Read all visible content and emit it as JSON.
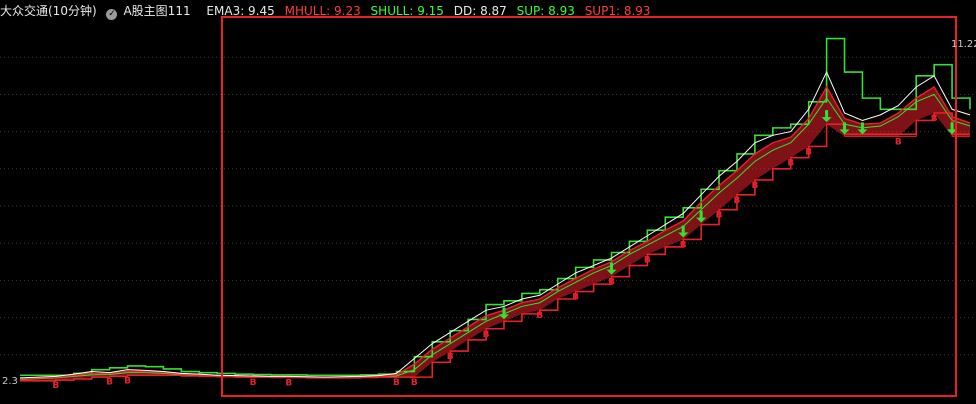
{
  "header": {
    "title": "大众交通(10分钟)",
    "indicator": "A股主图111",
    "ema3": "EMA3: 9.45",
    "mhull": "MHULL: 9.23",
    "shull": "SHULL: 9.15",
    "dd": "DD: 8.87",
    "sup": "SUP: 8.93",
    "sup1": "SUP1: 8.93"
  },
  "colors": {
    "background": "#000000",
    "price_line": "#ffffff",
    "red_band": "#e8202a",
    "green_band": "#35e035",
    "grid": "#3a3a3a",
    "frame": "#e8202a"
  },
  "chart_data": {
    "type": "line",
    "title": "大众交通(10分钟)",
    "xlabel": "",
    "ylabel": "",
    "ylim": [
      2.0,
      12.0
    ],
    "grid": true,
    "y_ticks_visible": [
      "2.3",
      "11.22"
    ],
    "legend": "top-left inline",
    "series": [
      {
        "name": "EMA3",
        "values": [
          2.38,
          2.4,
          2.42,
          2.48,
          2.55,
          2.52,
          2.6,
          2.58,
          2.55,
          2.5,
          2.48,
          2.45,
          2.44,
          2.43,
          2.42,
          2.42,
          2.41,
          2.4,
          2.41,
          2.42,
          2.44,
          2.5,
          2.9,
          3.3,
          3.6,
          3.9,
          4.2,
          4.3,
          4.5,
          4.6,
          4.9,
          5.2,
          5.4,
          5.6,
          5.9,
          6.2,
          6.5,
          6.8,
          7.3,
          7.8,
          8.2,
          8.7,
          8.9,
          9.0,
          9.6,
          10.6,
          9.5,
          9.3,
          9.45,
          9.7,
          10.2,
          10.5,
          9.6,
          9.45
        ]
      },
      {
        "name": "MHULL",
        "values": [
          2.36,
          2.38,
          2.4,
          2.45,
          2.5,
          2.5,
          2.56,
          2.55,
          2.53,
          2.49,
          2.46,
          2.44,
          2.43,
          2.42,
          2.41,
          2.41,
          2.4,
          2.4,
          2.4,
          2.41,
          2.42,
          2.46,
          2.75,
          3.15,
          3.45,
          3.75,
          4.05,
          4.2,
          4.4,
          4.5,
          4.8,
          5.05,
          5.3,
          5.5,
          5.8,
          6.05,
          6.35,
          6.6,
          7.1,
          7.55,
          7.95,
          8.4,
          8.7,
          8.85,
          9.35,
          10.2,
          9.35,
          9.2,
          9.23,
          9.5,
          9.9,
          10.2,
          9.4,
          9.23
        ]
      },
      {
        "name": "SHULL",
        "values": [
          2.34,
          2.36,
          2.38,
          2.42,
          2.46,
          2.47,
          2.52,
          2.52,
          2.5,
          2.47,
          2.45,
          2.43,
          2.42,
          2.41,
          2.4,
          2.4,
          2.39,
          2.39,
          2.39,
          2.4,
          2.41,
          2.43,
          2.6,
          3.0,
          3.3,
          3.6,
          3.9,
          4.1,
          4.3,
          4.4,
          4.7,
          4.95,
          5.2,
          5.4,
          5.7,
          5.95,
          6.2,
          6.45,
          6.9,
          7.35,
          7.75,
          8.2,
          8.5,
          8.7,
          9.2,
          9.9,
          9.2,
          9.1,
          9.15,
          9.4,
          9.8,
          10.0,
          9.3,
          9.15
        ]
      },
      {
        "name": "DD",
        "values": [
          2.3,
          2.3,
          2.32,
          2.35,
          2.4,
          2.42,
          2.45,
          2.45,
          2.45,
          2.43,
          2.42,
          2.41,
          2.4,
          2.4,
          2.39,
          2.39,
          2.38,
          2.38,
          2.38,
          2.39,
          2.4,
          2.4,
          2.4,
          2.8,
          3.1,
          3.4,
          3.7,
          3.9,
          4.1,
          4.2,
          4.5,
          4.7,
          4.9,
          5.1,
          5.4,
          5.7,
          5.9,
          6.1,
          6.5,
          6.9,
          7.3,
          7.7,
          8.0,
          8.3,
          8.6,
          9.2,
          8.87,
          8.87,
          8.87,
          8.87,
          9.3,
          9.5,
          8.87,
          8.87
        ]
      },
      {
        "name": "SUP",
        "values": [
          2.45,
          2.45,
          2.45,
          2.5,
          2.6,
          2.65,
          2.7,
          2.68,
          2.62,
          2.55,
          2.52,
          2.5,
          2.48,
          2.47,
          2.46,
          2.46,
          2.45,
          2.45,
          2.45,
          2.46,
          2.48,
          2.55,
          2.95,
          3.35,
          3.65,
          3.95,
          4.35,
          4.45,
          4.65,
          4.75,
          5.05,
          5.35,
          5.55,
          5.75,
          6.05,
          6.35,
          6.7,
          6.95,
          7.45,
          7.95,
          8.4,
          8.9,
          9.1,
          9.2,
          9.8,
          11.5,
          10.6,
          9.9,
          9.6,
          9.6,
          10.5,
          10.8,
          9.9,
          9.6
        ]
      },
      {
        "name": "SUP1",
        "values": [
          2.3,
          2.3,
          2.32,
          2.35,
          2.4,
          2.42,
          2.45,
          2.45,
          2.45,
          2.43,
          2.42,
          2.41,
          2.4,
          2.4,
          2.39,
          2.39,
          2.38,
          2.38,
          2.38,
          2.39,
          2.4,
          2.4,
          2.4,
          2.8,
          3.1,
          3.4,
          3.7,
          3.9,
          4.1,
          4.2,
          4.5,
          4.7,
          4.9,
          5.1,
          5.4,
          5.7,
          5.9,
          6.1,
          6.5,
          6.9,
          7.3,
          7.7,
          8.0,
          8.3,
          8.6,
          9.2,
          8.93,
          8.93,
          8.93,
          8.93,
          9.3,
          9.5,
          8.93,
          8.93
        ]
      }
    ],
    "buy_markers_B": [
      2,
      5,
      6,
      13,
      15,
      21,
      22,
      24,
      26,
      29,
      31,
      33,
      35,
      37,
      39,
      40,
      41,
      43,
      44,
      49,
      51
    ],
    "sell_markers_arrow": [
      27,
      33,
      37,
      38,
      45,
      46,
      47,
      52
    ]
  }
}
